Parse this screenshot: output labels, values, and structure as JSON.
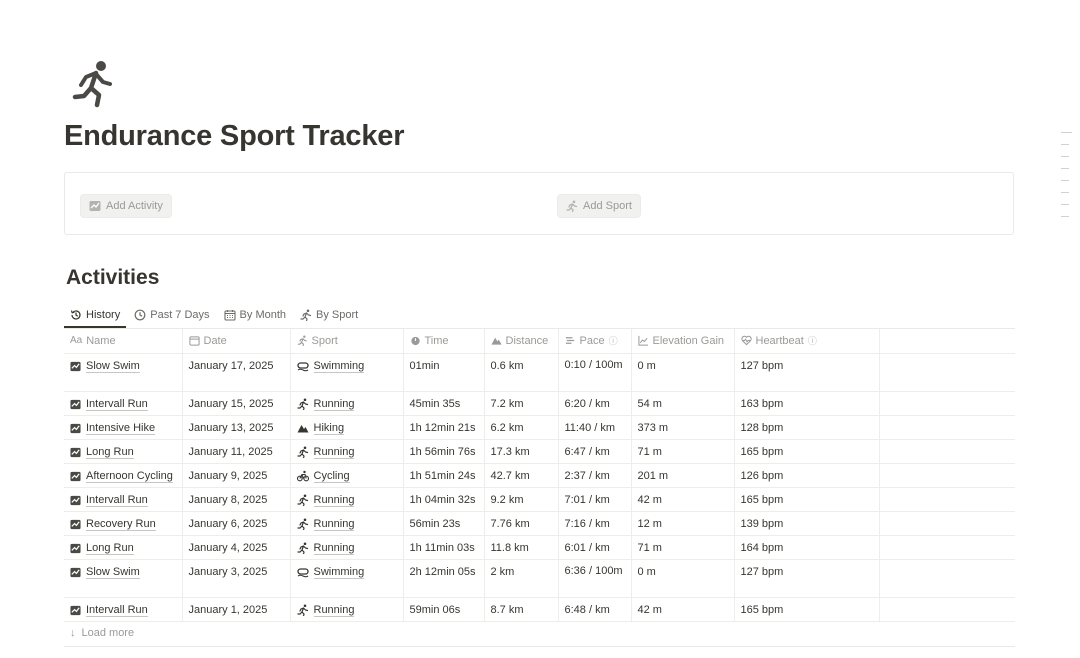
{
  "page": {
    "icon": "running-person-icon",
    "title": "Endurance Sport Tracker"
  },
  "buttons": {
    "add_activity": "Add Activity",
    "add_sport": "Add Sport"
  },
  "database": {
    "title": "Activities",
    "tabs": [
      {
        "label": "History",
        "icon": "history-icon",
        "active": true
      },
      {
        "label": "Past 7 Days",
        "icon": "clock-icon",
        "active": false
      },
      {
        "label": "By Month",
        "icon": "calendar-icon",
        "active": false
      },
      {
        "label": "By Sport",
        "icon": "running-icon",
        "active": false
      }
    ],
    "columns": {
      "name": "Name",
      "date": "Date",
      "sport": "Sport",
      "time": "Time",
      "distance": "Distance",
      "pace": "Pace",
      "elevation": "Elevation Gain",
      "heartbeat": "Heartbeat"
    },
    "rows": [
      {
        "name": "Slow Swim",
        "date": "January 17, 2025",
        "sport": "Swimming",
        "time": "01min",
        "distance": "0.6 km",
        "pace": "0:10 / 100m",
        "elevation": "0 m",
        "heartbeat": "127 bpm"
      },
      {
        "name": "Intervall Run",
        "date": "January 15, 2025",
        "sport": "Running",
        "time": "45min 35s",
        "distance": "7.2 km",
        "pace": "6:20 / km",
        "elevation": "54 m",
        "heartbeat": "163 bpm"
      },
      {
        "name": "Intensive Hike",
        "date": "January 13, 2025",
        "sport": "Hiking",
        "time": "1h 12min 21s",
        "distance": "6.2 km",
        "pace": "11:40 / km",
        "elevation": "373 m",
        "heartbeat": "128 bpm"
      },
      {
        "name": "Long Run",
        "date": "January 11, 2025",
        "sport": "Running",
        "time": "1h 56min 76s",
        "distance": "17.3 km",
        "pace": "6:47 / km",
        "elevation": "71 m",
        "heartbeat": "165 bpm"
      },
      {
        "name": "Afternoon Cycling",
        "date": "January 9, 2025",
        "sport": "Cycling",
        "time": "1h 51min 24s",
        "distance": "42.7 km",
        "pace": "2:37 / km",
        "elevation": "201 m",
        "heartbeat": "126 bpm"
      },
      {
        "name": "Intervall Run",
        "date": "January 8, 2025",
        "sport": "Running",
        "time": "1h 04min 32s",
        "distance": "9.2 km",
        "pace": "7:01 / km",
        "elevation": "42 m",
        "heartbeat": "165 bpm"
      },
      {
        "name": "Recovery Run",
        "date": "January 6, 2025",
        "sport": "Running",
        "time": "56min 23s",
        "distance": "7.76 km",
        "pace": "7:16 / km",
        "elevation": "12 m",
        "heartbeat": "139 bpm"
      },
      {
        "name": "Long Run",
        "date": "January 4, 2025",
        "sport": "Running",
        "time": "1h 11min 03s",
        "distance": "11.8 km",
        "pace": "6:01 / km",
        "elevation": "71 m",
        "heartbeat": "164 bpm"
      },
      {
        "name": "Slow Swim",
        "date": "January 3, 2025",
        "sport": "Swimming",
        "time": "2h 12min 05s",
        "distance": "2 km",
        "pace": "6:36 / 100m",
        "elevation": "0 m",
        "heartbeat": "127 bpm"
      },
      {
        "name": "Intervall Run",
        "date": "January 1, 2025",
        "sport": "Running",
        "time": "59min 06s",
        "distance": "8.7 km",
        "pace": "6:48 / km",
        "elevation": "42 m",
        "heartbeat": "165 bpm"
      }
    ],
    "load_more": "Load more"
  }
}
